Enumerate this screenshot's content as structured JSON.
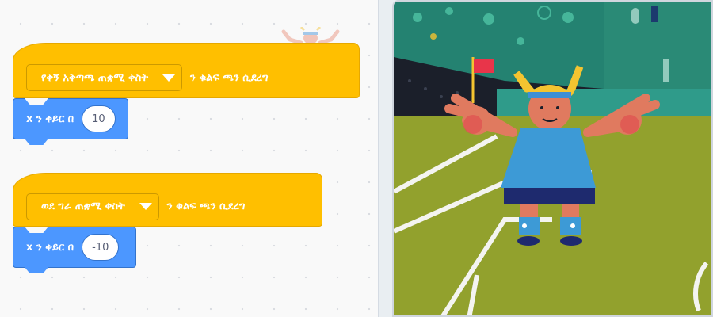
{
  "scripts": [
    {
      "hat_event": "የቀኝ አቅጣጫ ጠቋሚ ቀስት",
      "hat_suffix": "ን ቁልፍ ጫን ሲደረግ",
      "motion_label": "x ን ቀይር በ",
      "motion_value": "10"
    },
    {
      "hat_event": "ወደ ግራ ጠቋሚ ቀስት",
      "hat_suffix": "ን ቁልፍ ጫን ሲደረግ",
      "motion_label": "x ን ቀይር በ",
      "motion_value": "-10"
    }
  ],
  "colors": {
    "events_block": "#ffbf00",
    "motion_block": "#4c97ff",
    "code_background": "#f9f9f9"
  },
  "stage": {
    "backdrop": "soccer-field",
    "sprite": "goalkeeper-character"
  }
}
